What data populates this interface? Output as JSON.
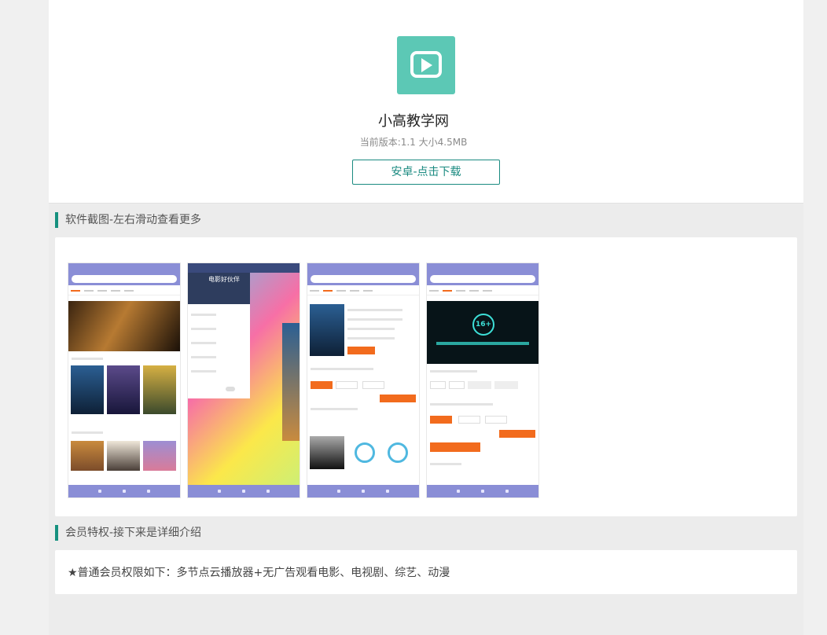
{
  "app": {
    "name": "小高教学网",
    "meta": "当前版本:1.1 大小4.5MB",
    "download_label": "安卓-点击下载",
    "icon_color": "#5cc8b5"
  },
  "sections": {
    "screenshots_title": "软件截图-左右滑动查看更多",
    "member_title": "会员特权-接下来是详细介绍",
    "member_text": "★普通会员权限如下：多节点云播放器+无广告观看电影、电视剧、综艺、动漫"
  },
  "screenshots": [
    {
      "label": "screenshot-home"
    },
    {
      "label": "screenshot-menu",
      "menu_title": "电影好伙伴"
    },
    {
      "label": "screenshot-detail"
    },
    {
      "label": "screenshot-player",
      "badge": "16+"
    }
  ],
  "colors": {
    "accent": "#16917f",
    "button_border": "#1a8a80",
    "phone_bar": "#8a8ed6",
    "orange": "#f26b1d"
  }
}
